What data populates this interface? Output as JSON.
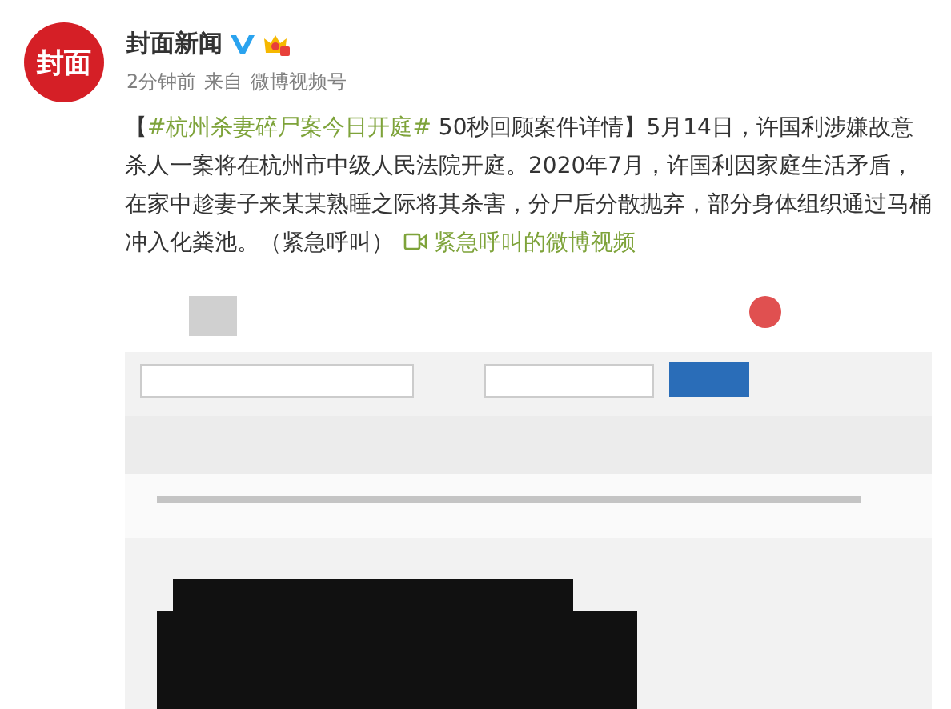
{
  "author": {
    "avatar_text": "封面",
    "name": "封面新闻",
    "verified": true,
    "time": "2分钟前",
    "source_prefix": "来自",
    "source": "微博视频号"
  },
  "post": {
    "segments": [
      {
        "kind": "text",
        "text": "【"
      },
      {
        "kind": "hashtag",
        "text": "#杭州杀妻碎尸案今日开庭#"
      },
      {
        "kind": "text",
        "text": " 50秒回顾案件详情】5月14日，许国利涉嫌故意杀人一案将在杭州市中级人民法院开庭。2020年7月，许国利因家庭生活矛盾，在家中趁妻子来某某熟睡之际将其杀害，分尸后分散抛弃，部分身体组织通过马桶冲入化粪池。（紧急呼叫）"
      },
      {
        "kind": "video_link",
        "text": "紧急呼叫的微博视频"
      }
    ]
  }
}
